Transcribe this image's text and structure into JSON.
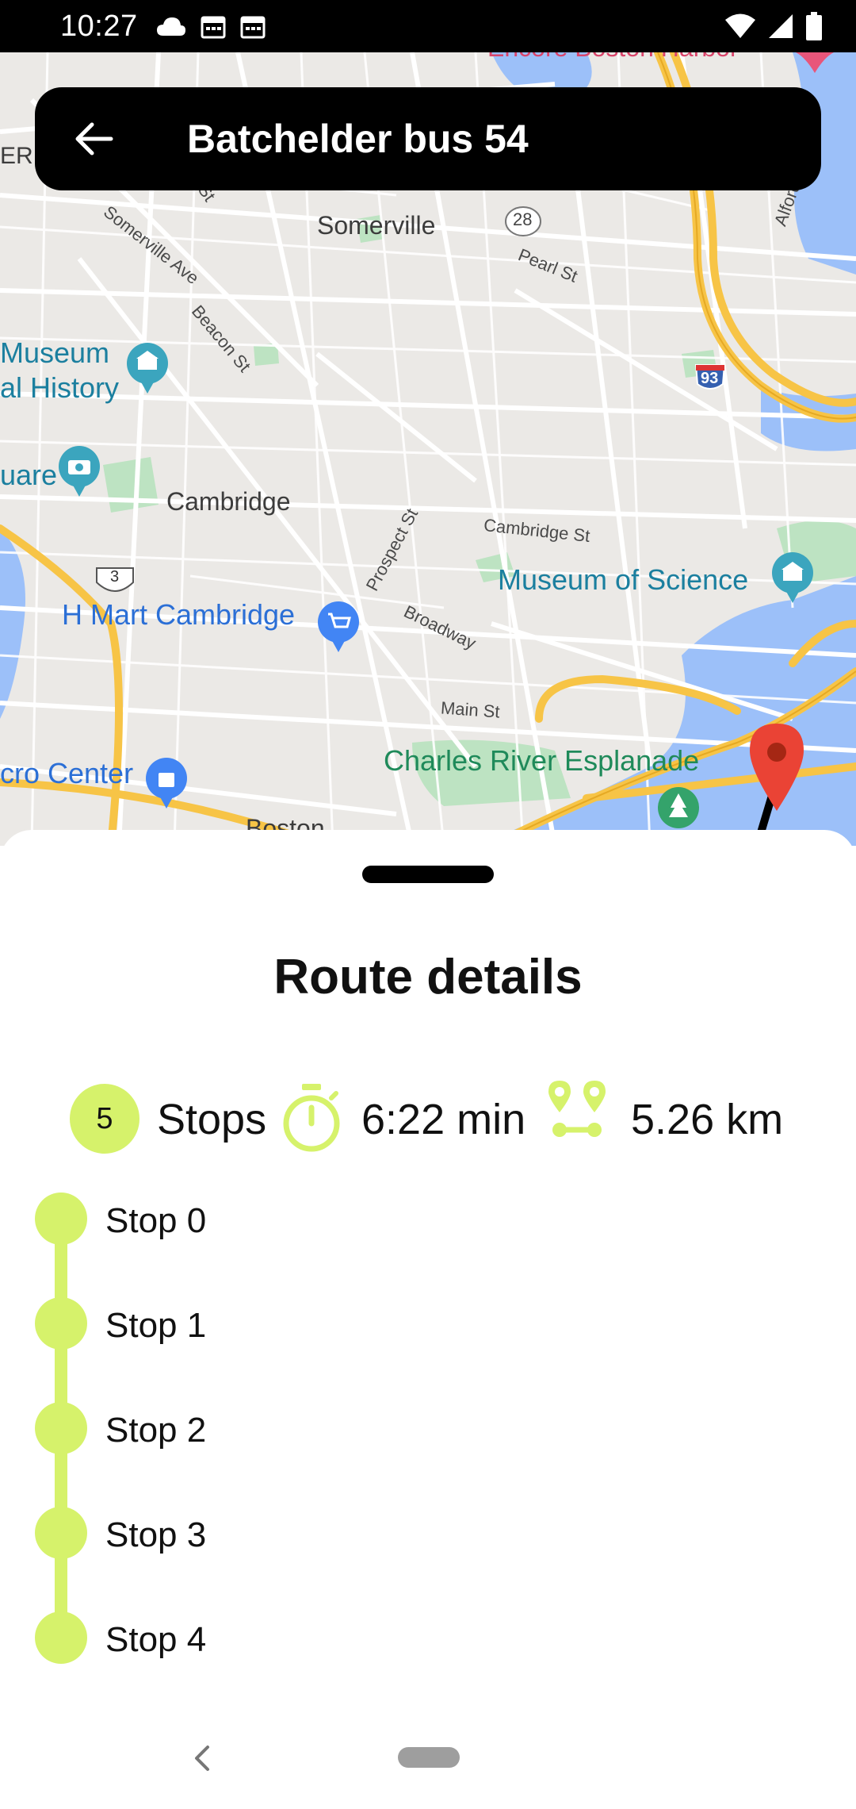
{
  "status_bar": {
    "time": "10:27"
  },
  "app_bar": {
    "title": "Batchelder bus 54"
  },
  "map": {
    "labels": {
      "encore": "Encore Boston Harbor",
      "somerville": "Somerville",
      "museum_line1": "Museum",
      "museum_line2": "al History",
      "square": "uare",
      "cambridge": "Cambridge",
      "hmart": "H Mart Cambridge",
      "museum_science": "Museum of Science",
      "esplanade": "Charles River Esplanade",
      "micro_center": "cro Center",
      "boston": "Boston",
      "er": "ER",
      "somerville_ave": "Somerville Ave",
      "beacon_st": "Beacon St",
      "pearl_st": "Pearl St",
      "prospect_st": "Prospect St",
      "cambridge_st": "Cambridge St",
      "broadway": "Broadway",
      "main_st": "Main St",
      "alford": "Alford",
      "st": "St"
    },
    "shields": {
      "route28": "28",
      "route93": "93",
      "route3": "3"
    },
    "colors": {
      "highway": "#f7c446",
      "water": "#9cc0f9",
      "park": "#bde3c2",
      "road": "#ffffff",
      "pin": "#ea4335"
    }
  },
  "sheet": {
    "title": "Route details",
    "stats": {
      "stops_count": "5",
      "stops_label": "Stops",
      "duration": "6:22 min",
      "distance": "5.26 km"
    },
    "stops": [
      "Stop 0",
      "Stop 1",
      "Stop 2",
      "Stop 3",
      "Stop 4"
    ],
    "accent_color": "#d6f26b"
  }
}
